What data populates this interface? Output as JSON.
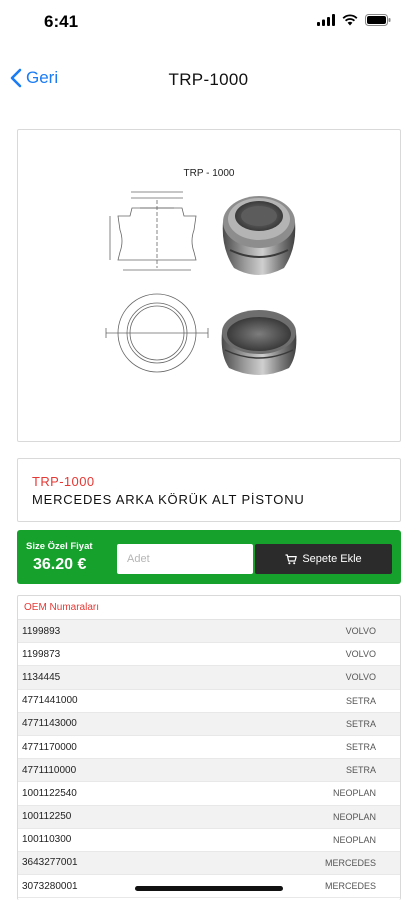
{
  "status_bar": {
    "time": "6:41"
  },
  "nav": {
    "back_label": "Geri",
    "title": "TRP-1000"
  },
  "drawing": {
    "title": "TRP - 1000"
  },
  "product": {
    "code": "TRP-1000",
    "name": "MERCEDES ARKA KÖRÜK ALT PİSTONU"
  },
  "price": {
    "label": "Size Özel Fiyat",
    "value": "36.20 €",
    "qty_placeholder": "Adet",
    "add_to_cart_label": "Sepete Ekle"
  },
  "oem": {
    "header": "OEM Numaraları",
    "rows": [
      {
        "number": "1199893",
        "brand": "VOLVO"
      },
      {
        "number": "1199873",
        "brand": "VOLVO"
      },
      {
        "number": "1134445",
        "brand": "VOLVO"
      },
      {
        "number": "4771441000",
        "brand": "SETRA"
      },
      {
        "number": "4771143000",
        "brand": "SETRA"
      },
      {
        "number": "4771170000",
        "brand": "SETRA"
      },
      {
        "number": "4771110000",
        "brand": "SETRA"
      },
      {
        "number": "1001122540",
        "brand": "NEOPLAN"
      },
      {
        "number": "100112250",
        "brand": "NEOPLAN"
      },
      {
        "number": "100110300",
        "brand": "NEOPLAN"
      },
      {
        "number": "3643277001",
        "brand": "MERCEDES"
      },
      {
        "number": "3073280001",
        "brand": "MERCEDES"
      }
    ]
  },
  "colors": {
    "accent_blue": "#1a7cf5",
    "price_green": "#16a12d",
    "code_red": "#e53935",
    "cart_button": "#2b2b2b"
  },
  "icons": {
    "back": "chevron-left-icon",
    "cart": "cart-icon",
    "signal": "signal-icon",
    "wifi": "wifi-icon",
    "battery": "battery-icon"
  }
}
